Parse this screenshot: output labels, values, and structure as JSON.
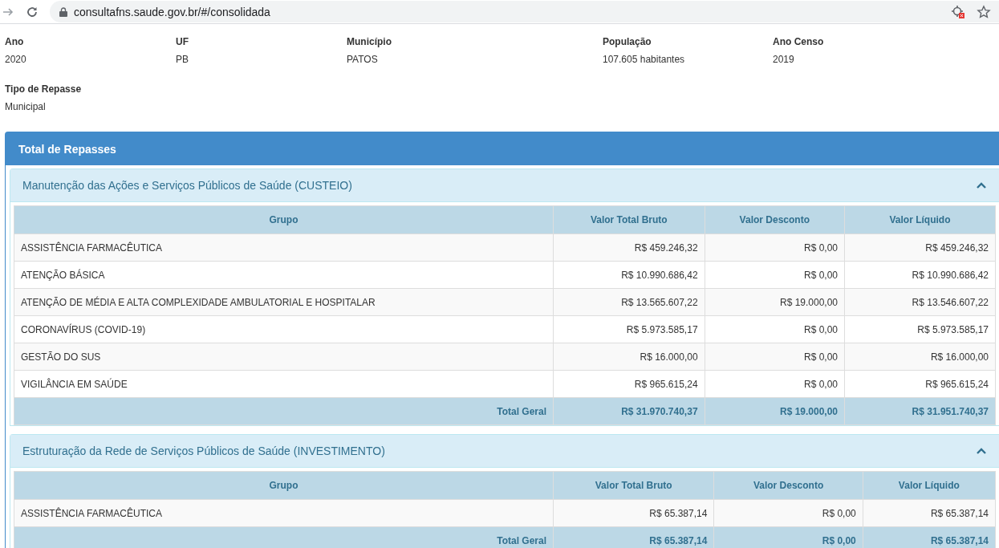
{
  "browser": {
    "url": "consultafns.saude.gov.br/#/consolidada"
  },
  "info": [
    {
      "label": "Ano",
      "value": "2020"
    },
    {
      "label": "UF",
      "value": "PB"
    },
    {
      "label": "Município",
      "value": "PATOS"
    },
    {
      "label": "População",
      "value": "107.605 habitantes"
    },
    {
      "label": "Ano Censo",
      "value": "2019"
    },
    {
      "label": "Tipo de Repasse",
      "value": "Municipal"
    }
  ],
  "panel": {
    "title": "Total de Repasses",
    "sections": [
      {
        "title": "Manutenção das Ações e Serviços Públicos de Saúde (CUSTEIO)",
        "expanded": true,
        "columns": [
          "Grupo",
          "Valor Total Bruto",
          "Valor Desconto",
          "Valor Líquido"
        ],
        "rows": [
          [
            "ASSISTÊNCIA FARMACÊUTICA",
            "R$ 459.246,32",
            "R$ 0,00",
            "R$ 459.246,32"
          ],
          [
            "ATENÇÃO BÁSICA",
            "R$ 10.990.686,42",
            "R$ 0,00",
            "R$ 10.990.686,42"
          ],
          [
            "ATENÇÃO DE MÉDIA E ALTA COMPLEXIDADE AMBULATORIAL E HOSPITALAR",
            "R$ 13.565.607,22",
            "R$ 19.000,00",
            "R$ 13.546.607,22"
          ],
          [
            "CORONAVÍRUS (COVID-19)",
            "R$ 5.973.585,17",
            "R$ 0,00",
            "R$ 5.973.585,17"
          ],
          [
            "GESTÃO DO SUS",
            "R$ 16.000,00",
            "R$ 0,00",
            "R$ 16.000,00"
          ],
          [
            "VIGILÂNCIA EM SAÚDE",
            "R$ 965.615,24",
            "R$ 0,00",
            "R$ 965.615,24"
          ]
        ],
        "total": [
          "Total Geral",
          "R$ 31.970.740,37",
          "R$ 19.000,00",
          "R$ 31.951.740,37"
        ]
      },
      {
        "title": "Estruturação da Rede de Serviços Públicos de Saúde (INVESTIMENTO)",
        "expanded": true,
        "columns": [
          "Grupo",
          "Valor Total Bruto",
          "Valor Desconto",
          "Valor Líquido"
        ],
        "rows": [
          [
            "ASSISTÊNCIA FARMACÊUTICA",
            "R$ 65.387,14",
            "R$ 0,00",
            "R$ 65.387,14"
          ]
        ],
        "total": [
          "Total Geral",
          "R$ 65.387,14",
          "R$ 0,00",
          "R$ 65.387,14"
        ]
      }
    ]
  }
}
